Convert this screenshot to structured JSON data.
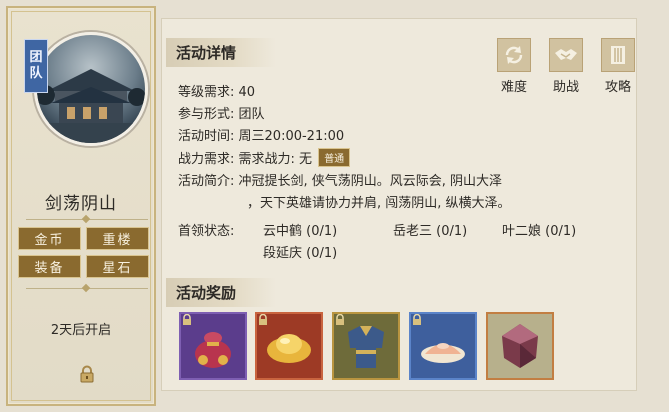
{
  "left_panel": {
    "team_tag": "团\n队",
    "title": "剑荡阴山",
    "tags": [
      "金币",
      "重楼",
      "装备",
      "星石"
    ],
    "open_text": "2天后开启"
  },
  "details": {
    "section_title": "活动详情",
    "rows": {
      "level": {
        "label": "等级需求:",
        "value": "40"
      },
      "form": {
        "label": "参与形式:",
        "value": "团队"
      },
      "time": {
        "label": "活动时间:",
        "value": "周三20:00-21:00"
      },
      "power": {
        "label": "战力需求:",
        "value": "需求战力: 无",
        "badge": "普通"
      },
      "intro": {
        "label": "活动简介:",
        "line1": "冲冠提长剑, 侠气荡阴山。风云际会, 阴山大泽",
        "line2": "，天下英雄请协力并肩, 闯荡阴山, 纵横大泽。"
      },
      "boss": {
        "label": "首领状态:",
        "items": [
          "云中鹤 (0/1)",
          "岳老三 (0/1)",
          "叶二娘 (0/1)",
          "段延庆 (0/1)"
        ]
      }
    }
  },
  "top_buttons": [
    {
      "label": "难度",
      "icon": "refresh-icon"
    },
    {
      "label": "助战",
      "icon": "handshake-icon"
    },
    {
      "label": "攻略",
      "icon": "book-icon"
    }
  ],
  "rewards": {
    "section_title": "活动奖励",
    "items": [
      {
        "icon": "money-bag-icon",
        "frame": "#7e5fb2",
        "bg": "#5b3d8c"
      },
      {
        "icon": "gold-ingot-icon",
        "frame": "#c9643f",
        "bg": "#9d3a25"
      },
      {
        "icon": "armor-icon",
        "frame": "#b99540",
        "bg": "#6e6b3a"
      },
      {
        "icon": "powder-icon",
        "frame": "#5b84c9",
        "bg": "#3e5f9d"
      },
      {
        "icon": "gem-stone-icon",
        "frame": "#c27e42",
        "bg": "#b7b08c"
      }
    ]
  }
}
